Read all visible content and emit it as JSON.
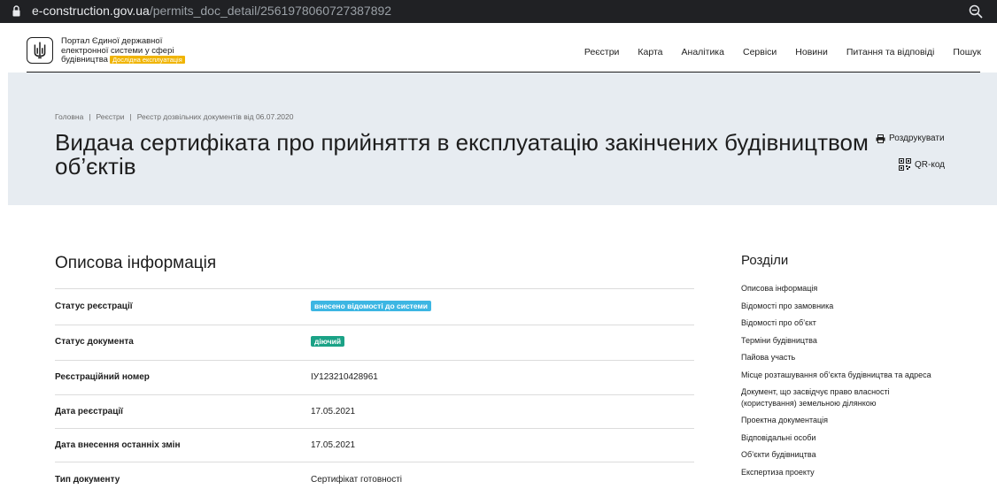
{
  "browser": {
    "url_host": "e-construction.gov.ua",
    "url_path": "/permits_doc_detail/2561978060727387892"
  },
  "header": {
    "logo_line1": "Портал Єдиної державної",
    "logo_line2": "електронної системи у сфері",
    "logo_line3": "будівництва",
    "logo_badge": "Дослідна експлуатація",
    "nav": [
      "Реєстри",
      "Карта",
      "Аналітика",
      "Сервіси",
      "Новини",
      "Питання та відповіді",
      "Пошук"
    ]
  },
  "breadcrumb": [
    "Головна",
    "Реєстри",
    "Реєстр дозвільних документів від 06.07.2020"
  ],
  "page": {
    "title": "Видача сертифіката про прийняття в експлуатацію закінчених будівництвом об’єктів",
    "print_label": "Роздрукувати",
    "qr_label": "QR-код"
  },
  "section": {
    "title": "Описова інформація",
    "rows": [
      {
        "label": "Статус реєстрації",
        "value": "внесено відомості до системи",
        "kind": "pill-blue"
      },
      {
        "label": "Статус документа",
        "value": "діючий",
        "kind": "pill-green"
      },
      {
        "label": "Реєстраційний номер",
        "value": "ІУ123210428961",
        "kind": "text"
      },
      {
        "label": "Дата реєстрації",
        "value": "17.05.2021",
        "kind": "text"
      },
      {
        "label": "Дата внесення останніх змін",
        "value": "17.05.2021",
        "kind": "text"
      },
      {
        "label": "Тип документу",
        "value": "Сертифікат готовності",
        "kind": "text"
      }
    ]
  },
  "sidebar": {
    "title": "Розділи",
    "items": [
      "Описова інформація",
      "Відомості про замовника",
      "Відомості про об’єкт",
      "Терміни будівництва",
      "Пайова участь",
      "Місце розташування об’єкта будівництва та адреса",
      "Документ, що засвідчує право власності (користування) земельною ділянкою",
      "Проектна документація",
      "Відповідальні особи",
      "Об’єкти будівництва",
      "Експертиза проекту"
    ]
  },
  "colors": {
    "hero_bg": "#e7ecf1",
    "pill_blue": "#3cb6e3",
    "pill_green": "#1ba286",
    "badge": "#f0b400"
  }
}
